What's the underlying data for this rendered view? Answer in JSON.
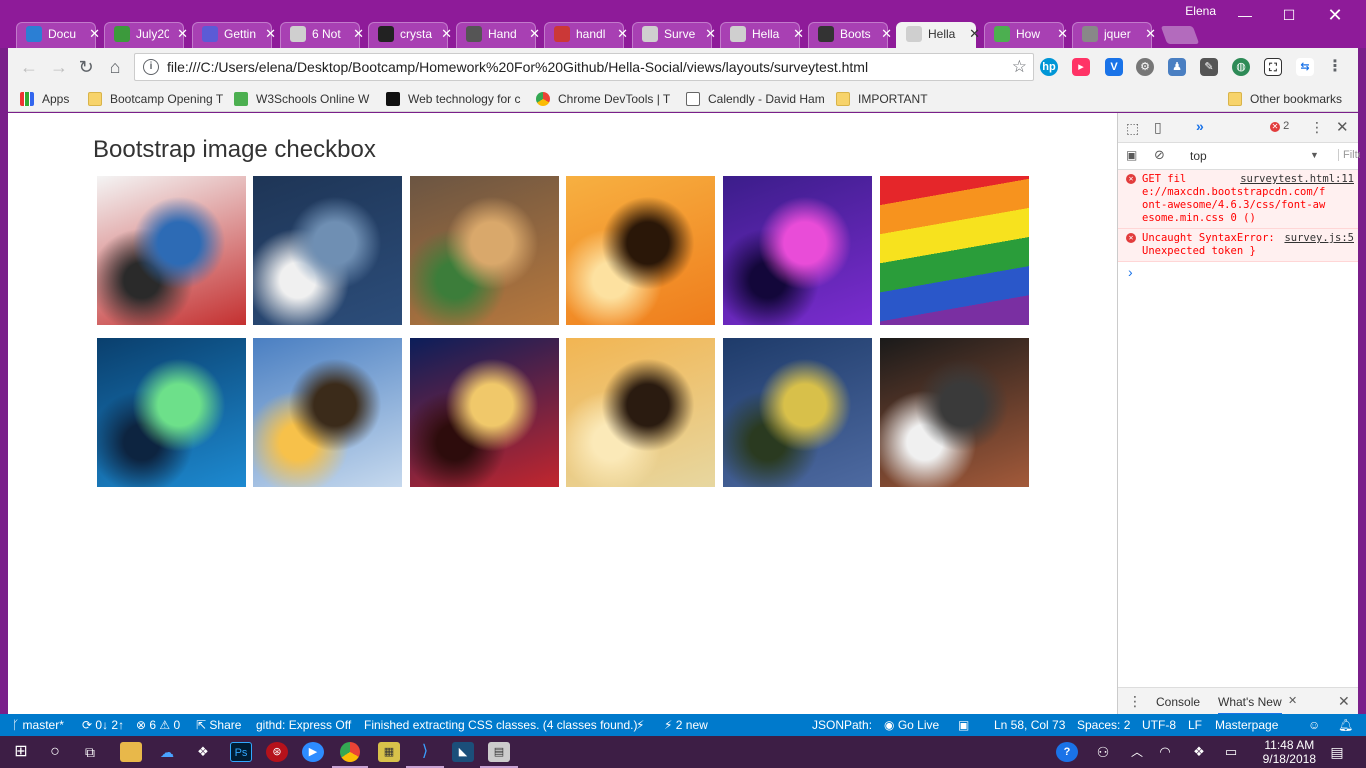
{
  "tabs": [
    {
      "label": "Docu",
      "icon": "vscode-icon",
      "color": "#2b7fd4"
    },
    {
      "label": "July20",
      "icon": "cloud-icon",
      "color": "#3c9a3c"
    },
    {
      "label": "Gettin",
      "icon": "globe-icon",
      "color": "#5b5bd6"
    },
    {
      "label": "6 Not",
      "icon": "page-icon",
      "color": "#cfcfcf"
    },
    {
      "label": "crysta",
      "icon": "github-icon",
      "color": "#222222"
    },
    {
      "label": "Hand",
      "icon": "handlebars-icon",
      "color": "#555555"
    },
    {
      "label": "handl",
      "icon": "npm-icon",
      "color": "#cb3837"
    },
    {
      "label": "Surve",
      "icon": "page-icon",
      "color": "#cfcfcf"
    },
    {
      "label": "Hella",
      "icon": "page-icon",
      "color": "#cfcfcf"
    },
    {
      "label": "Boots",
      "icon": "codepen-icon",
      "color": "#333333"
    },
    {
      "label": "Hella",
      "icon": "page-icon",
      "color": "#cfcfcf",
      "active": true
    },
    {
      "label": "How",
      "icon": "w3schools-icon",
      "color": "#4caf50"
    },
    {
      "label": "jquer",
      "icon": "c-letter-icon",
      "color": "#888888"
    }
  ],
  "profile_name": "Elena",
  "address": {
    "url": "file:///C:/Users/elena/Desktop/Bootcamp/Homework%20For%20Github/Hella-Social/views/layouts/surveytest.html"
  },
  "bookmarks": [
    {
      "label": "Apps",
      "icon": "apps-grid-icon"
    },
    {
      "label": "Bootcamp Opening T",
      "icon": "folder-icon"
    },
    {
      "label": "W3Schools Online W",
      "icon": "w3schools-icon"
    },
    {
      "label": "Web technology for c",
      "icon": "mdn-icon"
    },
    {
      "label": "Chrome DevTools | T",
      "icon": "chrome-devtools-icon"
    },
    {
      "label": "Calendly - David Ham",
      "icon": "calendly-icon"
    },
    {
      "label": "IMPORTANT",
      "icon": "folder-icon"
    }
  ],
  "other_bookmarks": "Other bookmarks",
  "page": {
    "heading": "Bootstrap image checkbox",
    "images": [
      {
        "name": "graduation-books",
        "colors": [
          "#f4f4f4",
          "#c43030",
          "#2d6bb5",
          "#2a2a2a"
        ]
      },
      {
        "name": "soccer-player",
        "colors": [
          "#1e3556",
          "#2c4d7a",
          "#6f8fb3",
          "#f0f0f0"
        ]
      },
      {
        "name": "food-platter",
        "colors": [
          "#6b5542",
          "#b7783d",
          "#d9a86b",
          "#3c7d3a"
        ]
      },
      {
        "name": "heart-sunset",
        "colors": [
          "#f7b041",
          "#ef7d1c",
          "#2a1708",
          "#fde1a0"
        ]
      },
      {
        "name": "concert-crowd",
        "colors": [
          "#3b1d8a",
          "#7b2ccf",
          "#e94cd8",
          "#13073a"
        ]
      },
      {
        "name": "rainbow-flag",
        "colors": [
          "#e5262a",
          "#f7931e",
          "#f7e21e",
          "#2a9d3a",
          "#2a57c9",
          "#7a2fa2"
        ]
      },
      {
        "name": "circuit-chip",
        "colors": [
          "#0a3f6d",
          "#1d8ad1",
          "#6de08a",
          "#0d2440"
        ]
      },
      {
        "name": "sun-rays-clouds",
        "colors": [
          "#4a7fc2",
          "#c6d9ee",
          "#3b2b1a",
          "#f7c14a"
        ]
      },
      {
        "name": "cinema-building",
        "colors": [
          "#0b1e5a",
          "#c2262e",
          "#f0c86a",
          "#2d0c0c"
        ]
      },
      {
        "name": "family-beach",
        "colors": [
          "#f2b552",
          "#e7d7a0",
          "#2a1b10",
          "#fbe9b8"
        ]
      },
      {
        "name": "starry-night",
        "colors": [
          "#1e3b6a",
          "#4e6aa1",
          "#d8c04a",
          "#2a3a20"
        ]
      },
      {
        "name": "bodybuilder",
        "colors": [
          "#1a1a1a",
          "#a35a3a",
          "#3a3a3a",
          "#f0f0f0"
        ]
      }
    ]
  },
  "devtools": {
    "tab_more": "»",
    "error_count": "2",
    "context": "top",
    "filter_placeholder": "Filter",
    "errors": [
      {
        "text": "GET fil e://maxcdn.bootstrapcdn.com/f ont-awesome/4.6.3/css/font-aw esome.min.css 0 ()",
        "source": "surveytest.html:11"
      },
      {
        "text": "Uncaught SyntaxError: Unexpected token }",
        "source": "survey.js:5"
      }
    ],
    "prompt": "›",
    "drawer_tabs": [
      "Console",
      "What's New"
    ]
  },
  "vscode_status": {
    "branch": "master*",
    "sync": "0↓ 2↑",
    "errors": "6",
    "warnings": "0",
    "share": "Share",
    "githd": "githd: Express Off",
    "message": "Finished extracting CSS classes. (4 classes found.)",
    "new_count": "2 new",
    "jsonpath": "JSONPath:",
    "golive": "Go Live",
    "position": "Ln 58, Col 73",
    "spaces": "Spaces: 2",
    "encoding": "UTF-8",
    "eol": "LF",
    "language": "Masterpage"
  },
  "taskbar": {
    "time": "11:48 AM",
    "date": "9/18/2018"
  },
  "colors": {
    "titlebar": "#8e1b99",
    "vscode_status": "#007acc",
    "taskbar": "#3d1e45"
  }
}
